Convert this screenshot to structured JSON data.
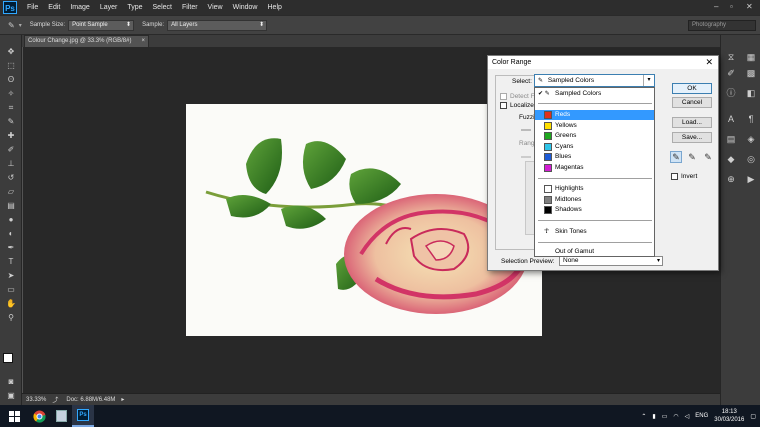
{
  "menubar": {
    "logo": "Ps",
    "items": [
      "File",
      "Edit",
      "Image",
      "Layer",
      "Type",
      "Select",
      "Filter",
      "View",
      "Window",
      "Help"
    ]
  },
  "options": {
    "sample_size_label": "Sample Size:",
    "sample_size_value": "Point Sample",
    "sample_label": "Sample:",
    "sample_value": "All Layers",
    "workspace": "Photography"
  },
  "document": {
    "tab_title": "Colour Change.jpg @ 33.3% (RGB/8#)",
    "zoom": "33.33%",
    "doc_size": "Doc: 6.88M/6.48M"
  },
  "dialog": {
    "title": "Color Range",
    "select_label": "Select:",
    "select_value": "Sampled Colors",
    "detect_faces": "Detect F",
    "localized": "Localized",
    "fuzziness": "Fuzzin",
    "range": "Range",
    "ok": "OK",
    "cancel": "Cancel",
    "load": "Load...",
    "save": "Save...",
    "invert": "Invert",
    "selection_preview_label": "Selection Preview:",
    "selection_preview_value": "None"
  },
  "dropdown": {
    "sampled": "Sampled Colors",
    "colors": [
      {
        "label": "Reds",
        "color": "#e0301e"
      },
      {
        "label": "Yellows",
        "color": "#ffe000"
      },
      {
        "label": "Greens",
        "color": "#1fa81f"
      },
      {
        "label": "Cyans",
        "color": "#2fc4e8"
      },
      {
        "label": "Blues",
        "color": "#1e5bd6"
      },
      {
        "label": "Magentas",
        "color": "#d21ed2"
      }
    ],
    "tones": [
      {
        "label": "Highlights",
        "color": "#ffffff"
      },
      {
        "label": "Midtones",
        "color": "#808080"
      },
      {
        "label": "Shadows",
        "color": "#000000"
      }
    ],
    "skin_tones": "Skin Tones",
    "out_of_gamut": "Out of Gamut"
  },
  "taskbar": {
    "lang": "ENG",
    "time": "18:13",
    "date": "30/03/2016"
  }
}
